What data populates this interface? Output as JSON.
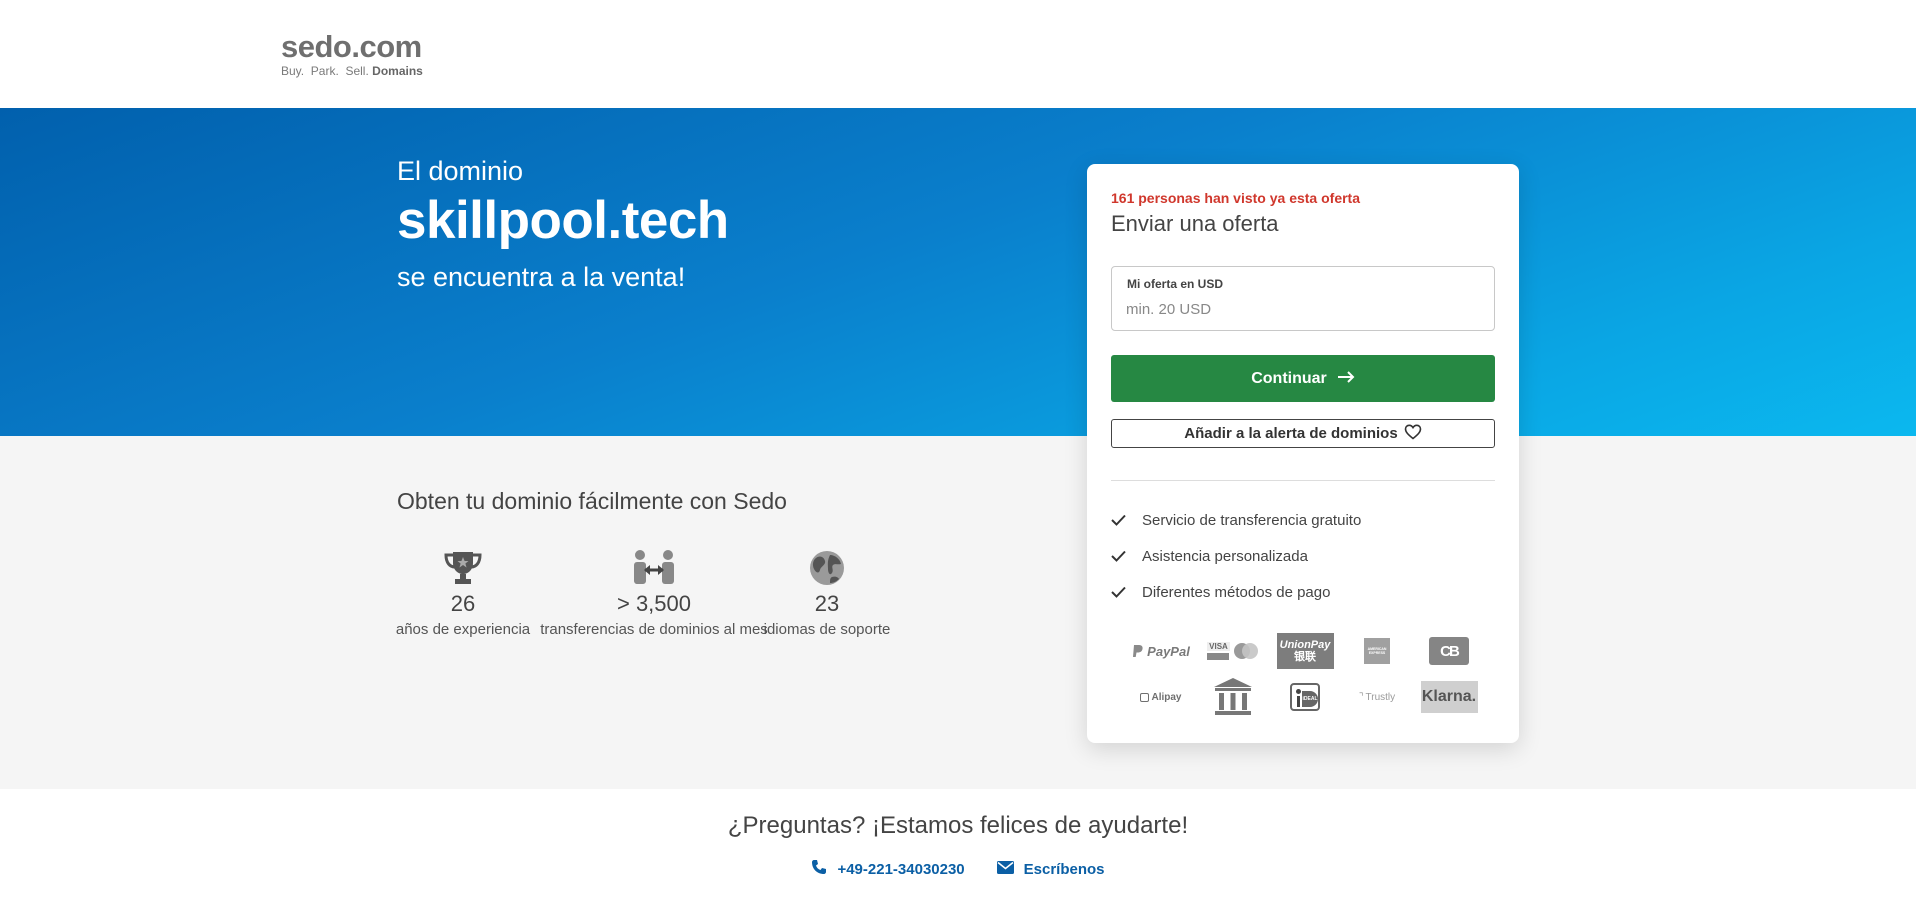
{
  "header": {
    "logo_main": "sedo.com",
    "logo_sub_prefix": "Buy.  Park.  Sell.",
    "logo_sub_bold": "Domains"
  },
  "hero": {
    "pre": "El dominio",
    "domain": "skillpool.tech",
    "post": "se encuentra a la venta!"
  },
  "benefits": {
    "title": "Obten tu dominio fácilmente con Sedo",
    "stats": [
      {
        "icon": "trophy-icon",
        "value": "26",
        "label": "años de experiencia"
      },
      {
        "icon": "transfer-icon",
        "value": "> 3,500",
        "label": "transferencias de dominios al mes"
      },
      {
        "icon": "globe-icon",
        "value": "23",
        "label": "idiomas de soporte"
      }
    ]
  },
  "offer_card": {
    "views_notice": "161 personas han visto ya esta oferta",
    "title": "Enviar una oferta",
    "field_label": "Mi oferta en USD",
    "field_placeholder": "min. 20 USD",
    "field_value": "",
    "continue_label": "Continuar",
    "alert_label": "Añadir a la alerta de dominios",
    "features": [
      "Servicio de transferencia gratuito",
      "Asistencia personalizada",
      "Diferentes métodos de pago"
    ],
    "payment_methods": [
      {
        "name": "paypal",
        "label": "PayPal"
      },
      {
        "name": "visa-mastercard",
        "label": "VISA"
      },
      {
        "name": "unionpay",
        "label": "UnionPay",
        "label_cn": "银联"
      },
      {
        "name": "american-express",
        "label": "AMERICAN EXPRESS"
      },
      {
        "name": "cb",
        "label": "CB"
      },
      {
        "name": "alipay",
        "label": "Alipay"
      },
      {
        "name": "bank-transfer",
        "label": ""
      },
      {
        "name": "ideal",
        "label": "iDEAL"
      },
      {
        "name": "trustly",
        "label": "Trustly"
      },
      {
        "name": "klarna",
        "label": "Klarna."
      }
    ]
  },
  "help": {
    "title": "¿Preguntas? ¡Estamos felices de ayudarte!",
    "phone": "+49-221-34030230",
    "email_label": "Escríbenos"
  },
  "colors": {
    "accent_green": "#268843",
    "alert_red": "#d0372c",
    "link_blue": "#0b5fa5",
    "hero_start": "#0160ad",
    "hero_end": "#0bb8ef"
  }
}
